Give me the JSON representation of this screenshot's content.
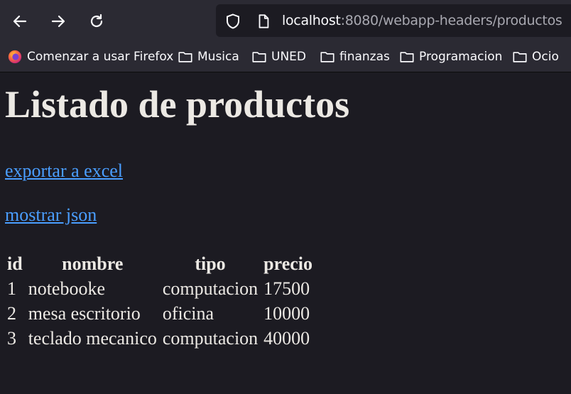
{
  "browser": {
    "url_host": "localhost",
    "url_rest": ":8080/webapp-headers/productos"
  },
  "bookmarks": [
    {
      "label": "Comenzar a usar Firefox",
      "icon": "firefox-icon"
    },
    {
      "label": "Musica",
      "icon": "folder-icon"
    },
    {
      "label": "UNED",
      "icon": "folder-icon"
    },
    {
      "label": "finanzas",
      "icon": "folder-icon"
    },
    {
      "label": "Programacion",
      "icon": "folder-icon"
    },
    {
      "label": "Ocio",
      "icon": "folder-icon"
    }
  ],
  "page": {
    "title": "Listado de productos",
    "link_excel": "exportar a excel",
    "link_json": "mostrar json"
  },
  "table": {
    "headers": [
      "id",
      "nombre",
      "tipo",
      "precio"
    ],
    "rows": [
      [
        "1",
        "notebooke",
        "computacion",
        "17500"
      ],
      [
        "2",
        "mesa escritorio",
        "oficina",
        "10000"
      ],
      [
        "3",
        "teclado mecanico",
        "computacion",
        "40000"
      ]
    ]
  },
  "colors": {
    "toolbar_bg": "#2b2a33",
    "page_bg": "#1c1b22",
    "link": "#4a9eff",
    "text": "#ece9e4"
  }
}
